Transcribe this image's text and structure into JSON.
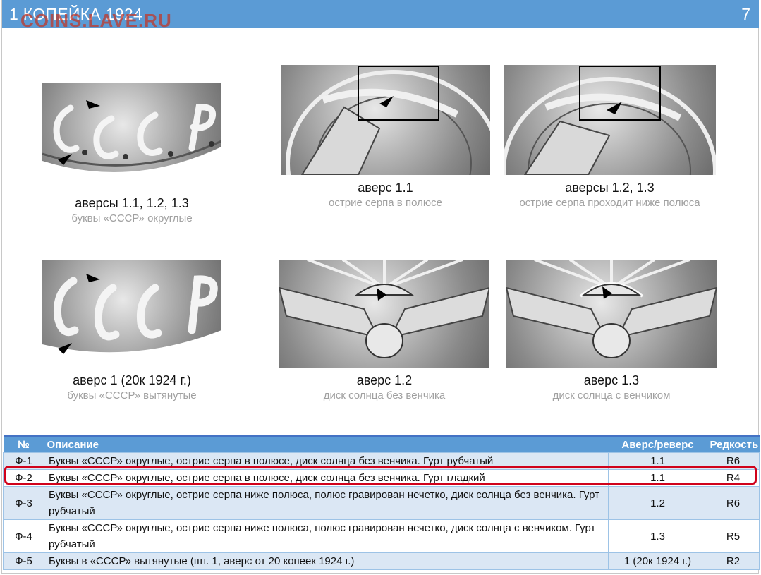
{
  "header": {
    "title": "1 КОПЕЙКА 1924",
    "watermark": "COINS.LAVE.RU",
    "page_number": "7",
    "accent_color": "#5b9bd5"
  },
  "figures": [
    {
      "id": "ussr-round",
      "main": "аверсы 1.1, 1.2, 1.3",
      "sub": "буквы «СССР» округлые",
      "icon": "cccp-letters-photo"
    },
    {
      "id": "sickle-pole",
      "main": "аверс 1.1",
      "sub": "острие серпа в полюсе",
      "icon": "globe-sickle-photo"
    },
    {
      "id": "sickle-below",
      "main": "аверсы 1.2, 1.3",
      "sub": "острие серпа проходит ниже полюса",
      "icon": "globe-sickle-photo"
    },
    {
      "id": "ussr-stretched",
      "main": "аверс 1 (20к 1924 г.)",
      "sub": "буквы «СССР» вытянутые",
      "icon": "cccp-letters-photo"
    },
    {
      "id": "sun-no-rim",
      "main": "аверс 1.2",
      "sub": "диск солнца без венчика",
      "icon": "sun-ribbon-photo"
    },
    {
      "id": "sun-rim",
      "main": "аверс 1.3",
      "sub": "диск солнца с венчиком",
      "icon": "sun-ribbon-photo"
    }
  ],
  "table": {
    "headers": [
      "№",
      "Описание",
      "Аверс/реверс",
      "Редкость"
    ],
    "rows": [
      {
        "num": "Ф-1",
        "desc": "Буквы «СССР» округлые, острие серпа в полюсе, диск солнца без венчика. Гурт рубчатый",
        "avers": "1.1",
        "rarity": "R6"
      },
      {
        "num": "Ф-2",
        "desc": "Буквы «СССР» округлые, острие серпа в полюсе, диск солнца без венчика. Гурт гладкий",
        "avers": "1.1",
        "rarity": "R4"
      },
      {
        "num": "Ф-3",
        "desc": "Буквы «СССР» округлые, острие серпа ниже полюса, полюс гравирован нечетко, диск солнца без венчика. Гурт рубчатый",
        "avers": "1.2",
        "rarity": "R6"
      },
      {
        "num": "Ф-4",
        "desc": "Буквы «СССР» округлые, острие серпа ниже полюса, полюс гравирован нечетко, диск солнца с венчиком. Гурт рубчатый",
        "avers": "1.3",
        "rarity": "R5"
      },
      {
        "num": "Ф-5",
        "desc": "Буквы в «СССР» вытянутые (шт. 1, аверс от 20 копеек 1924 г.)",
        "avers": "1 (20к 1924 г.)",
        "rarity": "R2"
      }
    ],
    "highlighted_row": "Ф-2",
    "highlight_color": "#d0021b"
  }
}
